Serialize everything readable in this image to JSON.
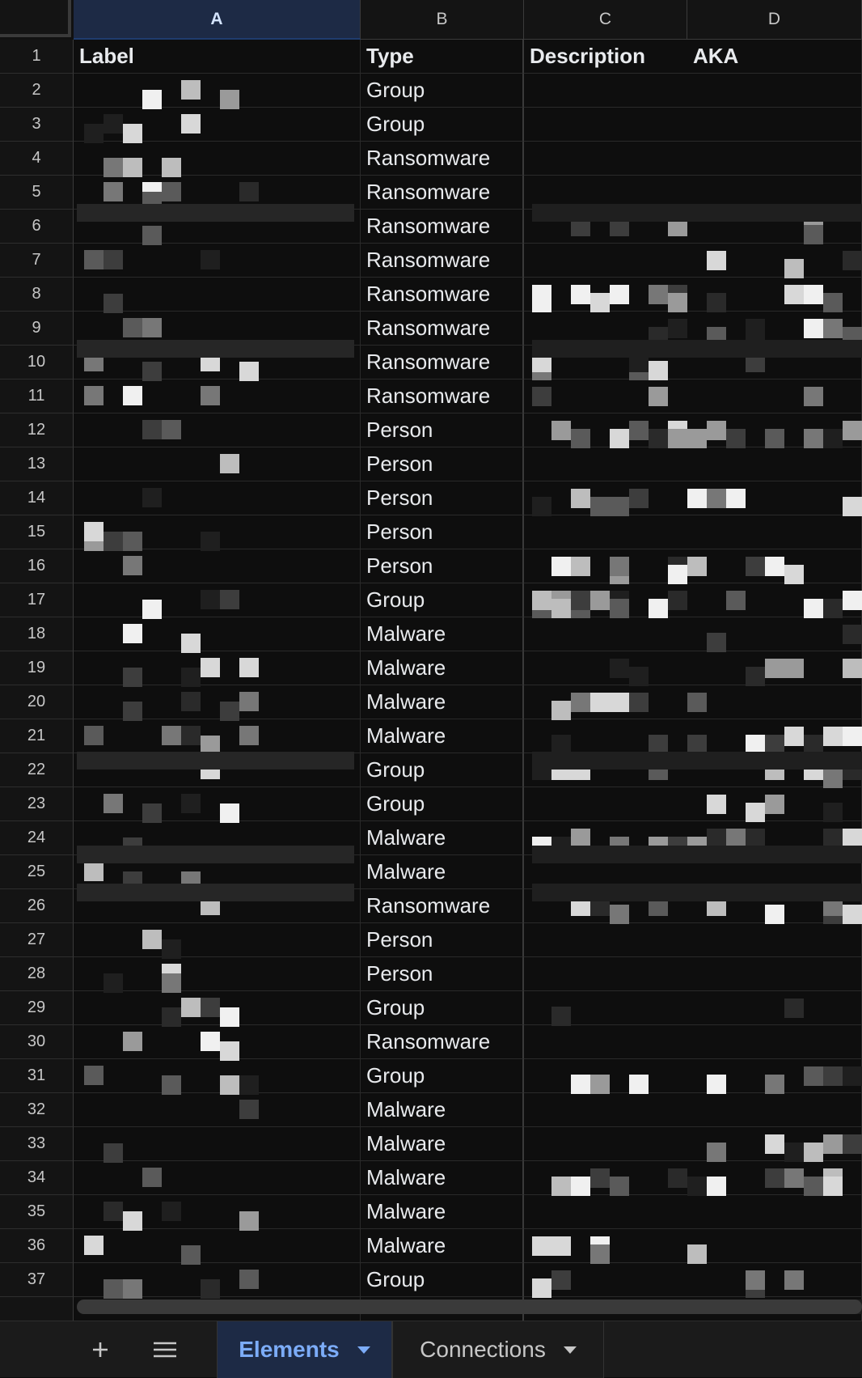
{
  "columns": [
    "A",
    "B",
    "C",
    "D"
  ],
  "selected_column": "A",
  "headers": {
    "label": "Label",
    "type": "Type",
    "description": "Description",
    "aka": "AKA"
  },
  "types": [
    "Group",
    "Group",
    "Ransomware",
    "Ransomware",
    "Ransomware",
    "Ransomware",
    "Ransomware",
    "Ransomware",
    "Ransomware",
    "Ransomware",
    "Person",
    "Person",
    "Person",
    "Person",
    "Person",
    "Group",
    "Malware",
    "Malware",
    "Malware",
    "Malware",
    "Group",
    "Group",
    "Malware",
    "Malware",
    "Ransomware",
    "Person",
    "Person",
    "Group",
    "Ransomware",
    "Group",
    "Malware",
    "Malware",
    "Malware",
    "Malware",
    "Malware",
    "Group"
  ],
  "row_numbers": [
    "1",
    "2",
    "3",
    "4",
    "5",
    "6",
    "7",
    "8",
    "9",
    "10",
    "11",
    "12",
    "13",
    "14",
    "15",
    "16",
    "17",
    "18",
    "19",
    "20",
    "21",
    "22",
    "23",
    "24",
    "25",
    "26",
    "27",
    "28",
    "29",
    "30",
    "31",
    "32",
    "33",
    "34",
    "35",
    "36",
    "37"
  ],
  "tabs": {
    "add_sheet_icon": "plus-icon",
    "all_sheets_icon": "hamburger-menu-icon",
    "items": [
      {
        "label": "Elements",
        "active": true
      },
      {
        "label": "Connections",
        "active": false
      }
    ]
  },
  "colors": {
    "background": "#111111",
    "selected_header": "#1d2a45",
    "active_tab_text": "#7cacf8"
  }
}
